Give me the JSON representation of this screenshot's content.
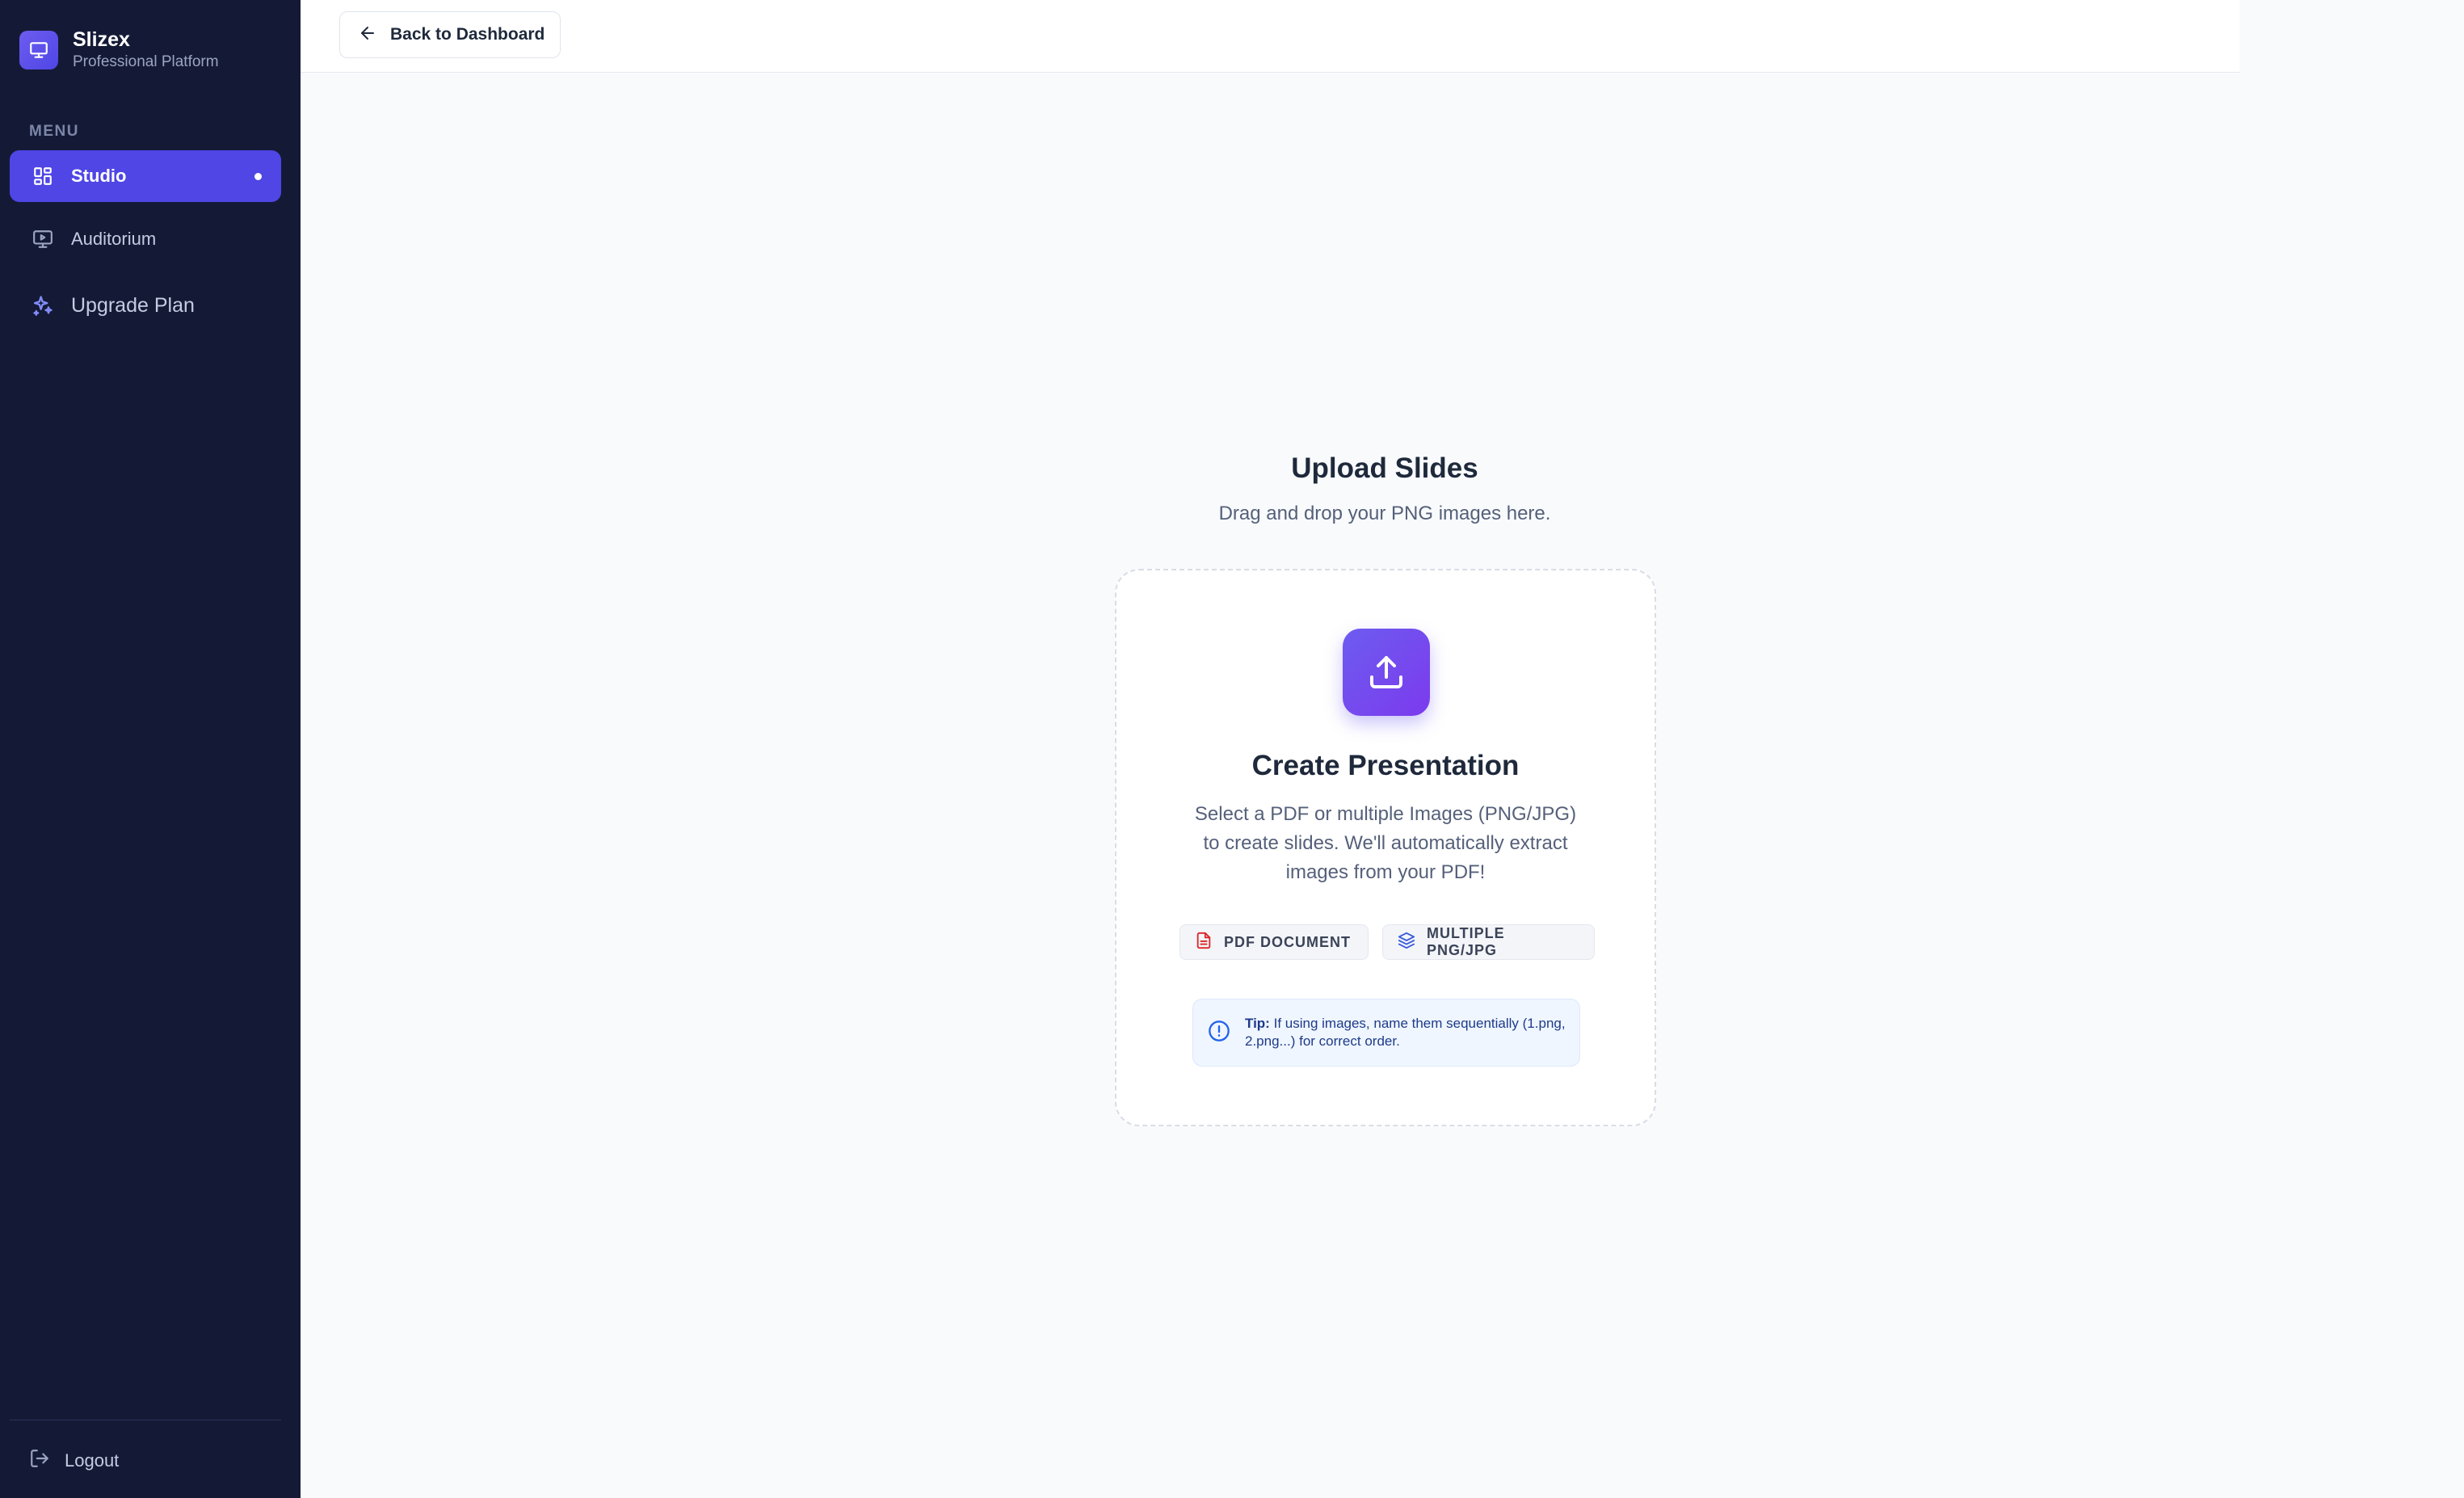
{
  "sidebar": {
    "brand": {
      "name": "Slizex",
      "subtitle": "Professional Platform",
      "logo_icon": "presentation-icon"
    },
    "menu_label": "MENU",
    "items": [
      {
        "label": "Studio",
        "icon": "grid-icon",
        "active": true
      },
      {
        "label": "Auditorium",
        "icon": "monitor-play-icon",
        "active": false
      },
      {
        "label": "Upgrade Plan",
        "icon": "sparkle-icon",
        "active": false
      }
    ],
    "logout_label": "Logout"
  },
  "topbar": {
    "back_label": "Back to Dashboard"
  },
  "main": {
    "title": "Upload Slides",
    "subtitle": "Drag and drop your PNG images here.",
    "card": {
      "title": "Create Presentation",
      "description": "Select a PDF or multiple Images (PNG/JPG) to create slides. We'll automatically extract images from your PDF!",
      "badges": [
        {
          "label": "PDF DOCUMENT",
          "icon": "file-icon"
        },
        {
          "label": "MULTIPLE PNG/JPG",
          "icon": "layers-icon"
        }
      ],
      "tip": {
        "prefix": "Tip:",
        "text": "If using images, name them sequentially (1.png, 2.png...) for correct order."
      }
    }
  },
  "colors": {
    "sidebar_bg": "#141a36",
    "accent": "#4f46e5",
    "gradient_start": "#6d5cf0",
    "gradient_end": "#7c3aed",
    "page_bg": "#f8fafc",
    "tip_bg": "#eff6ff",
    "tip_text": "#1e3a8a",
    "pdf_icon": "#dc2626",
    "layers_icon": "#3b5bdb"
  }
}
